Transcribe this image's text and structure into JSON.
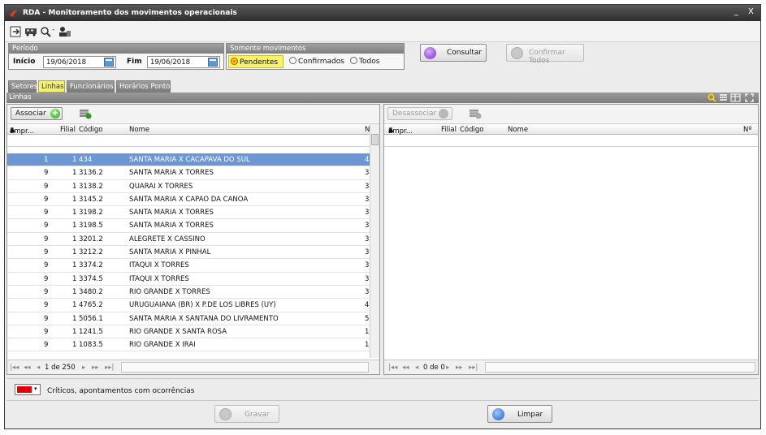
{
  "window": {
    "title": "RDA - Monitoramento dos movimentos operacionais",
    "minimize": "_",
    "close": "X"
  },
  "periodo": {
    "title": "Período",
    "inicio_label": "Início",
    "inicio_value": "19/06/2018",
    "fim_label": "Fim",
    "fim_value": "19/06/2018"
  },
  "movimentos": {
    "title": "Somente movimentos",
    "options": [
      "Pendentes",
      "Confirmados",
      "Todos"
    ],
    "selected": "Pendentes"
  },
  "buttons": {
    "consultar": "Consultar",
    "confirmar_todos": "Confirmar Todos",
    "associar": "Associar",
    "desassociar": "Desassociar",
    "gravar": "Gravar",
    "limpar": "Limpar"
  },
  "tabs": [
    "Setores",
    "Linhas",
    "Funcionários",
    "Horários Ponto"
  ],
  "active_tab": "Linhas",
  "section": {
    "title": "Linhas"
  },
  "left_grid": {
    "columns": [
      "Empr...",
      "Filial",
      "Código",
      "Nome",
      "N"
    ],
    "rows": [
      {
        "empresa": "1",
        "filial": "1",
        "codigo": "434",
        "nome": "SANTA MARIA X CACAPAVA DO SUL",
        "n": "4"
      },
      {
        "empresa": "9",
        "filial": "1",
        "codigo": "3136.2",
        "nome": "SANTA MARIA X TORRES",
        "n": "3"
      },
      {
        "empresa": "9",
        "filial": "1",
        "codigo": "3138.2",
        "nome": "QUARAI X TORRES",
        "n": "3"
      },
      {
        "empresa": "9",
        "filial": "1",
        "codigo": "3145.2",
        "nome": "SANTA MARIA X CAPAO DA CANOA",
        "n": "3"
      },
      {
        "empresa": "9",
        "filial": "1",
        "codigo": "3198.2",
        "nome": "SANTA MARIA X TORRES",
        "n": "3"
      },
      {
        "empresa": "9",
        "filial": "1",
        "codigo": "3198.5",
        "nome": "SANTA MARIA X TORRES",
        "n": "3"
      },
      {
        "empresa": "9",
        "filial": "1",
        "codigo": "3201.2",
        "nome": "ALEGRETE X CASSINO",
        "n": "3"
      },
      {
        "empresa": "9",
        "filial": "1",
        "codigo": "3212.2",
        "nome": "SANTA MARIA X PINHAL",
        "n": "3"
      },
      {
        "empresa": "9",
        "filial": "1",
        "codigo": "3374.2",
        "nome": "ITAQUI X TORRES",
        "n": "3"
      },
      {
        "empresa": "9",
        "filial": "1",
        "codigo": "3374.5",
        "nome": "ITAQUI X TORRES",
        "n": "3"
      },
      {
        "empresa": "9",
        "filial": "1",
        "codigo": "3480.2",
        "nome": "RIO GRANDE X TORRES",
        "n": "3"
      },
      {
        "empresa": "9",
        "filial": "1",
        "codigo": "4765.2",
        "nome": "URUGUAIANA (BR) X P.DE LOS LIBRES (UY)",
        "n": "4"
      },
      {
        "empresa": "9",
        "filial": "1",
        "codigo": "5056.1",
        "nome": "SANTA MARIA X SANTANA DO LIVRAMENTO",
        "n": "5"
      },
      {
        "empresa": "9",
        "filial": "1",
        "codigo": "1241.5",
        "nome": "RIO GRANDE X SANTA ROSA",
        "n": "1"
      },
      {
        "empresa": "9",
        "filial": "1",
        "codigo": "1083.5",
        "nome": "RIO GRANDE X IRAI",
        "n": "1"
      }
    ],
    "pager": "1 de 250"
  },
  "right_grid": {
    "columns": [
      "Empr...",
      "Filial",
      "Código",
      "Nome",
      "Nº"
    ],
    "pager": "0 de 0"
  },
  "legend": {
    "text": "Críticos, apontamentos com ocorrências",
    "color": "#e00000"
  },
  "colors": {
    "selection": "#6d96d4",
    "active_tab": "#f7f26b",
    "titlebar": "#3c3c3c"
  }
}
